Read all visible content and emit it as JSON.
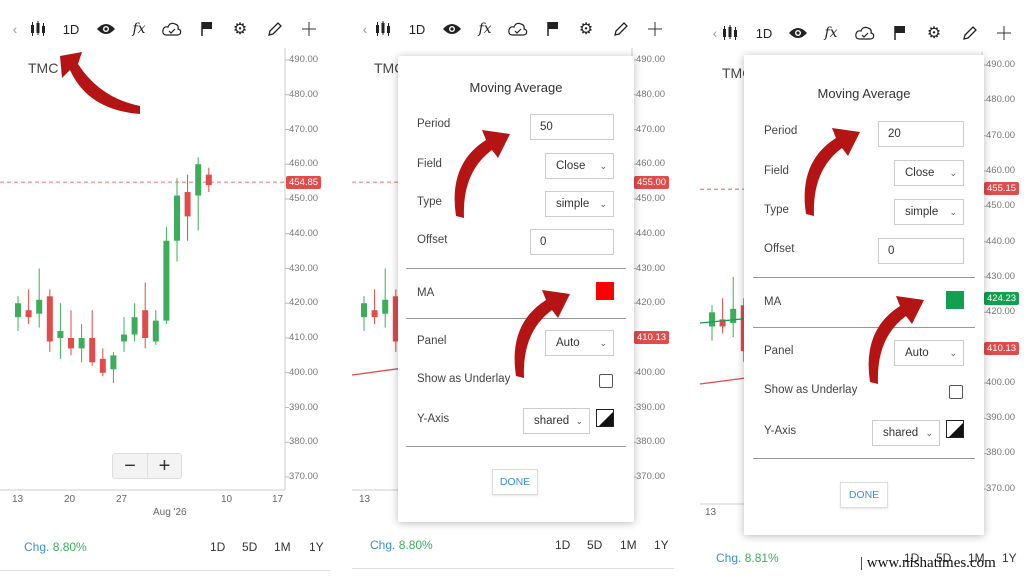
{
  "toolbar": {
    "chevron_left": "‹",
    "period": "1D",
    "fx_label": "fx"
  },
  "panel1": {
    "symbol": "TMC",
    "price_labels": [
      "490.00",
      "480.00",
      "470.00",
      "460.00",
      "450.00",
      "440.00",
      "430.00",
      "420.00",
      "410.00",
      "400.00",
      "390.00",
      "380.00",
      "370.00"
    ],
    "current_price": "454.85",
    "date_labels": [
      "13",
      "20",
      "27",
      "Aug '26",
      "10",
      "17"
    ],
    "chg_label": "Chg.",
    "chg_value": "8.80%",
    "ranges": [
      "1D",
      "5D",
      "1M",
      "1Y"
    ],
    "zoom_out": "−",
    "zoom_in": "+"
  },
  "panel2": {
    "symbol": "TMC",
    "price_labels": [
      "490.00",
      "480.00",
      "470.00",
      "460.00",
      "450.00",
      "440.00",
      "430.00",
      "420.00",
      "410.00",
      "400.00",
      "390.00",
      "380.00",
      "370.00"
    ],
    "current_price": "455.00",
    "ma_price": "410.13",
    "date_labels": [
      "13"
    ],
    "chg_label": "Chg.",
    "chg_value": "8.80%",
    "ranges": [
      "1D",
      "5D",
      "1M",
      "1Y"
    ],
    "dialog": {
      "title": "Moving Average",
      "period_label": "Period",
      "period_value": "50",
      "field_label": "Field",
      "field_value": "Close",
      "type_label": "Type",
      "type_value": "simple",
      "offset_label": "Offset",
      "offset_value": "0",
      "ma_label": "MA",
      "ma_color": "#ff0000",
      "panel_label": "Panel",
      "panel_value": "Auto",
      "underlay_label": "Show as Underlay",
      "yaxis_label": "Y-Axis",
      "yaxis_value": "shared",
      "done_label": "DONE"
    }
  },
  "panel3": {
    "symbol": "TMC",
    "price_labels": [
      "490.00",
      "480.00",
      "470.00",
      "460.00",
      "450.00",
      "440.00",
      "430.00",
      "420.00",
      "410.00",
      "400.00",
      "390.00",
      "380.00",
      "370.00"
    ],
    "current_price": "455.15",
    "ma_price": "424.23",
    "ma2_price": "410.13",
    "date_labels": [
      "13"
    ],
    "chg_label": "Chg.",
    "chg_value": "8.81%",
    "ranges": [
      "1D",
      "5D",
      "1M",
      "1Y"
    ],
    "dialog": {
      "title": "Moving Average",
      "period_label": "Period",
      "period_value": "20",
      "field_label": "Field",
      "field_value": "Close",
      "type_label": "Type",
      "type_value": "simple",
      "offset_label": "Offset",
      "offset_value": "0",
      "ma_label": "MA",
      "ma_color": "#12a050",
      "panel_label": "Panel",
      "panel_value": "Auto",
      "underlay_label": "Show as Underlay",
      "yaxis_label": "Y-Axis",
      "yaxis_value": "shared",
      "done_label": "DONE"
    }
  },
  "watermark": "| www.nishatimes.com",
  "colors": {
    "up": "#3cae5b",
    "down": "#e14b4b",
    "accent": "#3a8fd9",
    "price_tag": "#e14b4b",
    "arrow": "#b41414"
  },
  "chart_data": {
    "type": "candlestick",
    "symbol": "TMC",
    "y_range": [
      370,
      490
    ],
    "candles": [
      {
        "o": 416,
        "h": 422,
        "l": 412,
        "c": 420
      },
      {
        "o": 418,
        "h": 424,
        "l": 414,
        "c": 416
      },
      {
        "o": 417,
        "h": 430,
        "l": 413,
        "c": 421
      },
      {
        "o": 422,
        "h": 424,
        "l": 406,
        "c": 409
      },
      {
        "o": 410,
        "h": 420,
        "l": 404,
        "c": 412
      },
      {
        "o": 410,
        "h": 418,
        "l": 405,
        "c": 407
      },
      {
        "o": 407,
        "h": 414,
        "l": 403,
        "c": 410
      },
      {
        "o": 410,
        "h": 418,
        "l": 402,
        "c": 403
      },
      {
        "o": 404,
        "h": 407,
        "l": 399,
        "c": 400
      },
      {
        "o": 401,
        "h": 406,
        "l": 397,
        "c": 405
      },
      {
        "o": 409,
        "h": 416,
        "l": 406,
        "c": 411
      },
      {
        "o": 411,
        "h": 420,
        "l": 409,
        "c": 416
      },
      {
        "o": 418,
        "h": 426,
        "l": 407,
        "c": 410
      },
      {
        "o": 409,
        "h": 418,
        "l": 408,
        "c": 415
      },
      {
        "o": 415,
        "h": 442,
        "l": 414,
        "c": 438
      },
      {
        "o": 438,
        "h": 456,
        "l": 432,
        "c": 451
      },
      {
        "o": 452,
        "h": 457,
        "l": 438,
        "c": 445
      },
      {
        "o": 451,
        "h": 462,
        "l": 441,
        "c": 460
      },
      {
        "o": 457,
        "h": 459,
        "l": 452,
        "c": 454
      }
    ]
  }
}
